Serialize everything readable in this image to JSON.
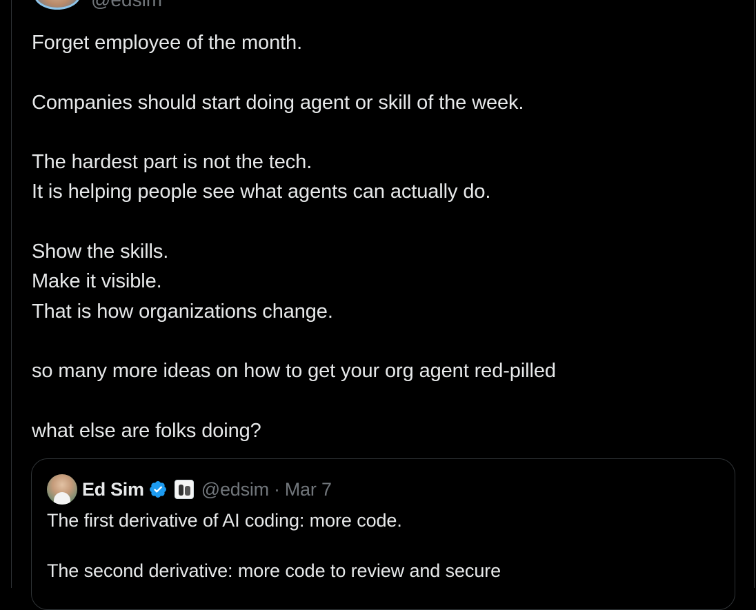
{
  "top_author": {
    "handle": "@edsim"
  },
  "tweet": {
    "paragraphs": [
      [
        "Forget employee of the month."
      ],
      [
        "Companies should start doing agent or skill of the week."
      ],
      [
        "The hardest part is not the tech.",
        "It is helping people see what agents can actually do."
      ],
      [
        "Show the skills.",
        "Make it visible.",
        "That is how organizations change."
      ],
      [
        "so many more ideas on how to get your org agent red-pilled"
      ],
      [
        "what else are folks doing?"
      ]
    ]
  },
  "quote": {
    "author_name": "Ed Sim",
    "handle": "@edsim",
    "separator": "·",
    "date": "Mar 7",
    "lines": [
      "The first derivative of AI coding: more code.",
      "",
      "The second derivative: more code to review and secure"
    ]
  },
  "colors": {
    "background": "#000000",
    "text": "#e7e9ea",
    "muted": "#71767b",
    "border": "#2f3336",
    "verified": "#1d9bf0"
  },
  "icons": {
    "verified": "verified-checkmark-badge",
    "affiliate": "affiliate-badge"
  }
}
